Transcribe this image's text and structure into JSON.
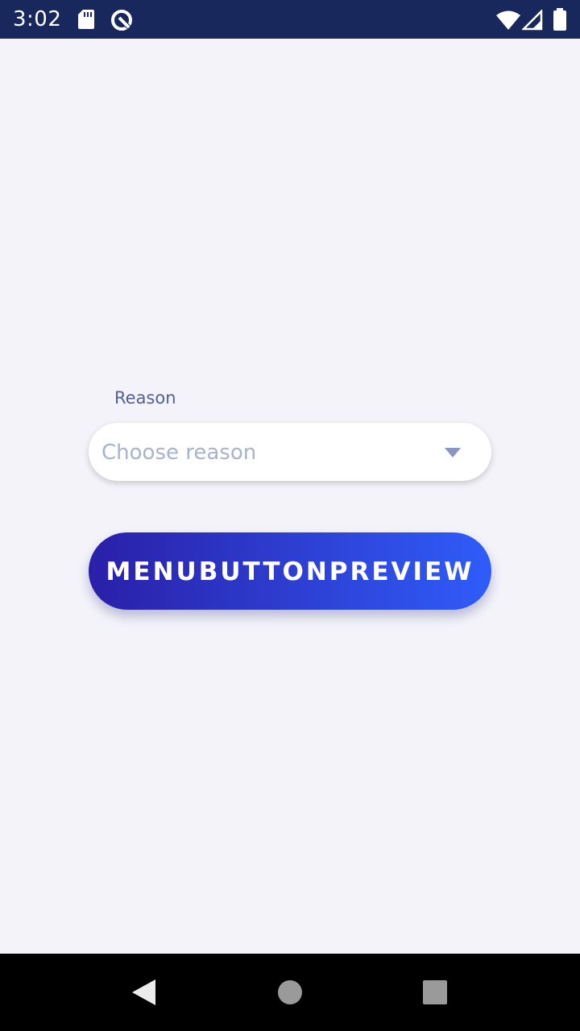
{
  "status_bar": {
    "time": "3:02",
    "icons": [
      "sd-card-icon",
      "data-saver-icon",
      "wifi-icon",
      "cell-signal-icon",
      "battery-icon"
    ]
  },
  "form": {
    "reason_label": "Reason",
    "reason_placeholder": "Choose reason",
    "submit_label": "MENUBUTTONPREVIEW"
  },
  "nav_bar": {
    "buttons": [
      "back-icon",
      "home-icon",
      "recents-icon"
    ]
  },
  "colors": {
    "status_bar_bg": "#18275c",
    "page_bg": "#f3f3f9",
    "label_text": "#55608f",
    "placeholder_text": "#a9b3cf",
    "button_gradient_start": "#2a1fa8",
    "button_gradient_end": "#2f5cf9"
  }
}
